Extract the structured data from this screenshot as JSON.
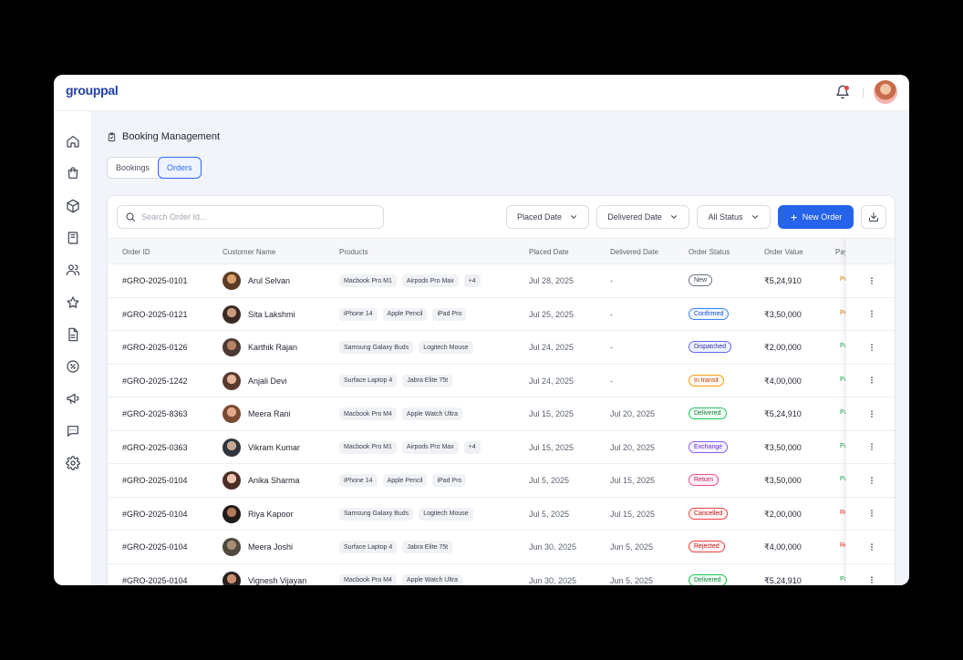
{
  "app": {
    "logo": "grouppal"
  },
  "page": {
    "title": "Booking Management"
  },
  "tabs": [
    {
      "label": "Bookings",
      "active": false
    },
    {
      "label": "Orders",
      "active": true
    }
  ],
  "toolbar": {
    "search_placeholder": "Search Order Id...",
    "placed_date": "Placed Date",
    "delivered_date": "Delivered Date",
    "all_status": "All Status",
    "new_order": "New Order"
  },
  "columns": [
    "Order ID",
    "Customer Name",
    "Products",
    "Placed Date",
    "Delivered Date",
    "Order Status",
    "Order Value",
    "Pay"
  ],
  "sidebar_icons": [
    "home-icon",
    "shopping-bag-icon",
    "box-icon",
    "book-icon",
    "users-icon",
    "star-icon",
    "document-icon",
    "discount-icon",
    "megaphone-icon",
    "chat-icon",
    "settings-icon"
  ],
  "status_styles": {
    "New": {
      "color": "#374151",
      "border": "#6b7280",
      "bg": "#ffffff"
    },
    "Confirmed": {
      "color": "#1d4ed8",
      "border": "#3b82f6",
      "bg": "#eff6ff"
    },
    "Dispatched": {
      "color": "#3730a3",
      "border": "#6366f1",
      "bg": "#eef2ff"
    },
    "In transit": {
      "color": "#c2410c",
      "border": "#f59e0b",
      "bg": "#fff7ed"
    },
    "Delivered": {
      "color": "#15803d",
      "border": "#22c55e",
      "bg": "#f0fdf4"
    },
    "Exchange": {
      "color": "#6d28d9",
      "border": "#8b5cf6",
      "bg": "#f5f3ff"
    },
    "Return": {
      "color": "#be185d",
      "border": "#ec4899",
      "bg": "#fdf2f8"
    },
    "Cancelled": {
      "color": "#b91c1c",
      "border": "#ef4444",
      "bg": "#fef2f2"
    },
    "Rejected": {
      "color": "#b91c1c",
      "border": "#ef4444",
      "bg": "#fef2f2"
    }
  },
  "payment_styles": {
    "Pe": "#d97706",
    "Pa": "#16a34a",
    "Re": "#dc2626"
  },
  "orders": [
    {
      "id": "#GRO-2025-0101",
      "customer": "Arul Selvan",
      "products": [
        "Macbook Pro M1",
        "Airpods Pro Max"
      ],
      "more": "+4",
      "placed": "Jul 28, 2025",
      "delivered": "-",
      "status": "New",
      "value": "₹5,24,910",
      "pay": "Pe",
      "avatar": [
        "#d9a06b",
        "#5a3b24"
      ]
    },
    {
      "id": "#GRO-2025-0121",
      "customer": "Sita Lakshmi",
      "products": [
        "iPhone 14",
        "Apple Pencil",
        "iPad Pro"
      ],
      "more": "",
      "placed": "Jul 25, 2025",
      "delivered": "-",
      "status": "Confirmed",
      "value": "₹3,50,000",
      "pay": "Pe",
      "avatar": [
        "#c99a7f",
        "#3b2a24"
      ]
    },
    {
      "id": "#GRO-2025-0126",
      "customer": "Karthik Rajan",
      "products": [
        "Samsung Galaxy Buds",
        "Logitech Mouse"
      ],
      "more": "",
      "placed": "Jul 24, 2025",
      "delivered": "-",
      "status": "Dispatched",
      "value": "₹2,00,000",
      "pay": "Pa",
      "avatar": [
        "#b98263",
        "#4a3a33"
      ]
    },
    {
      "id": "#GRO-2025-1242",
      "customer": "Anjali Devi",
      "products": [
        "Surface Laptop 4",
        "Jabra Elite 75t"
      ],
      "more": "",
      "placed": "Jul 24, 2025",
      "delivered": "-",
      "status": "In transit",
      "value": "₹4,00,000",
      "pay": "Pa",
      "avatar": [
        "#e2b49a",
        "#5b3a2e"
      ]
    },
    {
      "id": "#GRO-2025-8363",
      "customer": "Meera Rani",
      "products": [
        "Macbook Pro M4",
        "Apple Watch Ultra"
      ],
      "more": "",
      "placed": "Jul 15, 2025",
      "delivered": "Jul 20, 2025",
      "status": "Delivered",
      "value": "₹5,24,910",
      "pay": "Pa",
      "avatar": [
        "#e0a98a",
        "#7a4a32"
      ]
    },
    {
      "id": "#GRO-2025-0363",
      "customer": "Vikram Kumar",
      "products": [
        "Macbook Pro M1",
        "Airpods Pro Max"
      ],
      "more": "+4",
      "placed": "Jul 15, 2025",
      "delivered": "Jul 20, 2025",
      "status": "Exchange",
      "value": "₹3,50,000",
      "pay": "Pa",
      "avatar": [
        "#c6a892",
        "#30343d"
      ]
    },
    {
      "id": "#GRO-2025-0104",
      "customer": "Anika Sharma",
      "products": [
        "iPhone 14",
        "Apple Pencil",
        "iPad Pro"
      ],
      "more": "",
      "placed": "Jul 5, 2025",
      "delivered": "Jul 15, 2025",
      "status": "Return",
      "value": "₹3,50,000",
      "pay": "Pa",
      "avatar": [
        "#edc5ae",
        "#4a2e25"
      ]
    },
    {
      "id": "#GRO-2025-0104",
      "customer": "Riya Kapoor",
      "products": [
        "Samsung Galaxy Buds",
        "Logitech Mouse"
      ],
      "more": "",
      "placed": "Jul 5, 2025",
      "delivered": "Jul 15, 2025",
      "status": "Cancelled",
      "value": "₹2,00,000",
      "pay": "Re",
      "avatar": [
        "#b07858",
        "#1f1b1b"
      ]
    },
    {
      "id": "#GRO-2025-0104",
      "customer": "Meera Joshi",
      "products": [
        "Surface Laptop 4",
        "Jabra Elite 75t"
      ],
      "more": "",
      "placed": "Jun 30, 2025",
      "delivered": "Jun 5, 2025",
      "status": "Rejected",
      "value": "₹4,00,000",
      "pay": "Re",
      "avatar": [
        "#a98d74",
        "#4f4a3c"
      ]
    },
    {
      "id": "#GRO-2025-0104",
      "customer": "Vignesh Vijayan",
      "products": [
        "Macbook Pro M4",
        "Apple Watch Ultra"
      ],
      "more": "",
      "placed": "Jun 30, 2025",
      "delivered": "Jun 5, 2025",
      "status": "Delivered",
      "value": "₹5,24,910",
      "pay": "Pa",
      "avatar": [
        "#c98f6e",
        "#2a2220"
      ]
    }
  ]
}
